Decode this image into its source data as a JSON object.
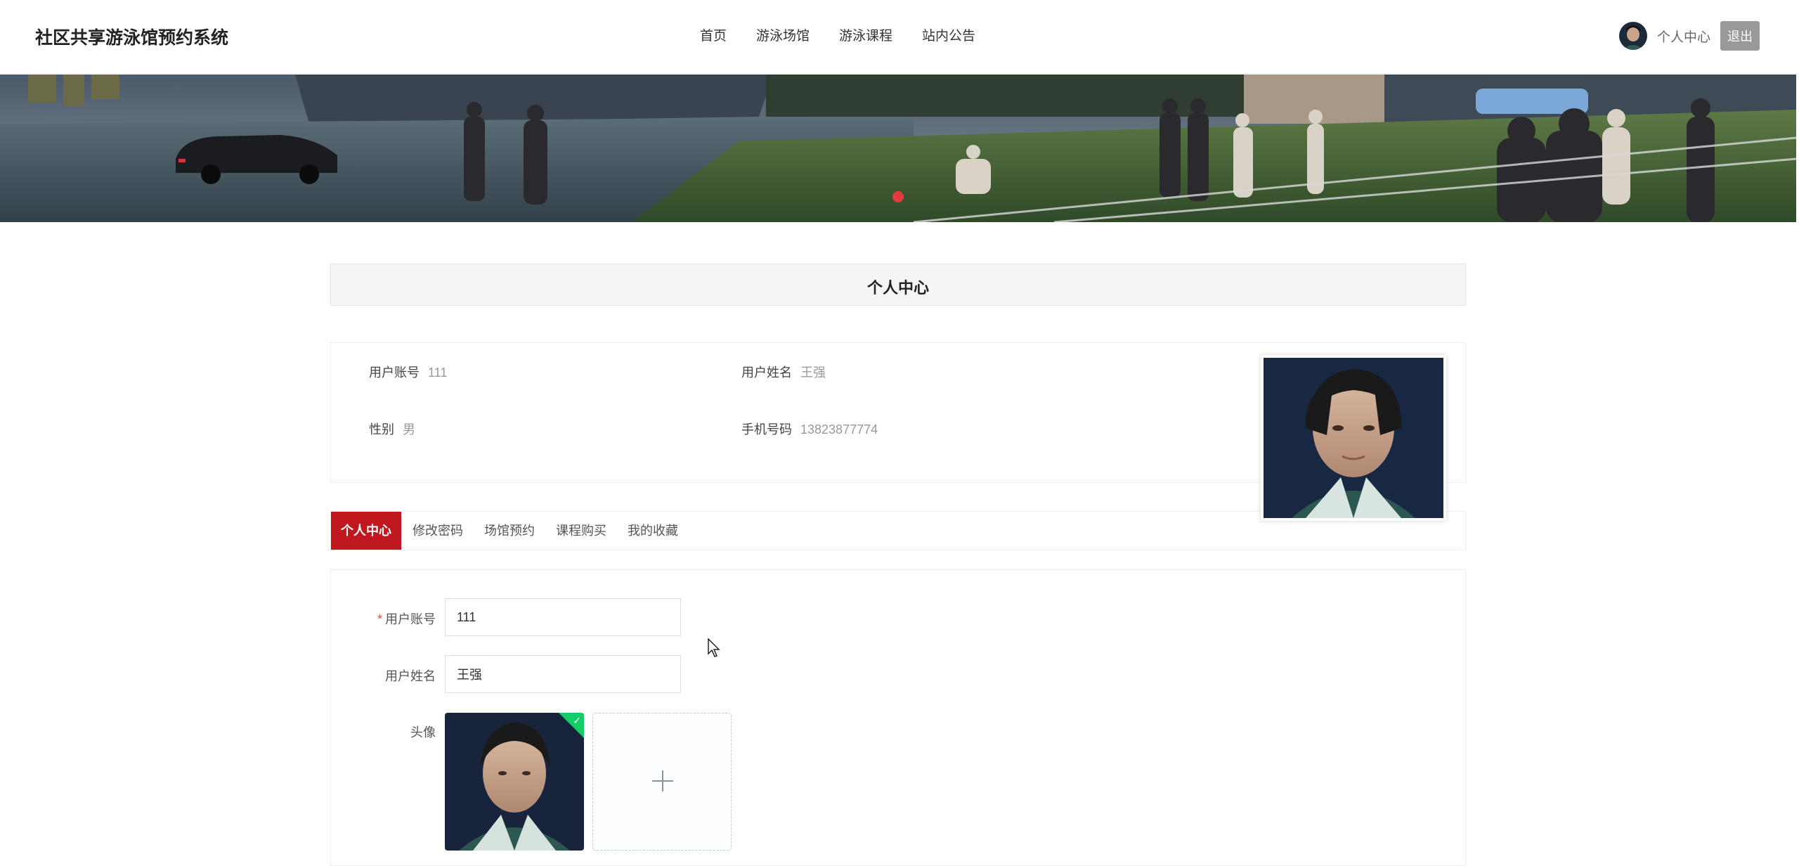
{
  "header": {
    "logo": "社区共享游泳馆预约系统",
    "nav": [
      "首页",
      "游泳场馆",
      "游泳课程",
      "站内公告"
    ],
    "user_center": "个人中心",
    "logout": "退出"
  },
  "page_title": "个人中心",
  "profile": {
    "account_label": "用户账号",
    "account_value": "111",
    "name_label": "用户姓名",
    "name_value": "王强",
    "gender_label": "性别",
    "gender_value": "男",
    "phone_label": "手机号码",
    "phone_value": "13823877774"
  },
  "tabs": [
    "个人中心",
    "修改密码",
    "场馆预约",
    "课程购买",
    "我的收藏"
  ],
  "form": {
    "required_mark": "*",
    "account_label": "用户账号",
    "account_value": "111",
    "name_label": "用户姓名",
    "name_value": "王强",
    "avatar_label": "头像"
  },
  "icons": [
    "user-avatar-icon",
    "plus-icon",
    "check-icon",
    "cursor-icon"
  ],
  "colors": {
    "accent": "#c0181e",
    "success": "#13ce66",
    "dot": "#e13b3b"
  }
}
